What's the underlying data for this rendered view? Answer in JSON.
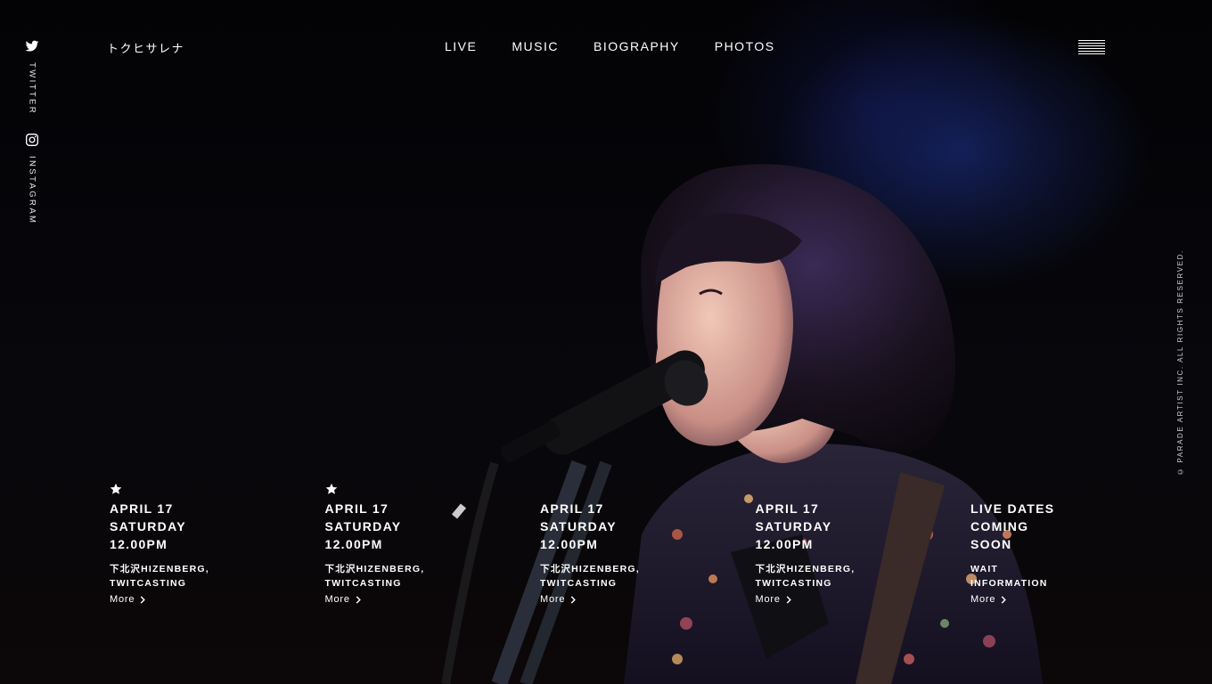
{
  "site": {
    "logo": "トクヒサレナ"
  },
  "social": [
    {
      "icon": "twitter-icon",
      "label": "TWITTER"
    },
    {
      "icon": "instagram-icon",
      "label": "INSTAGRAM"
    }
  ],
  "nav": {
    "items": [
      "LIVE",
      "MUSIC",
      "BIOGRAPHY",
      "PHOTOS"
    ]
  },
  "menu_icon": "hamburger-menu-icon",
  "copyright": "© PARADE ARTIST INC. ALL RIGHTS RESERVED.",
  "events": [
    {
      "starred": true,
      "line1": "APRIL 17",
      "line2": "SATURDAY",
      "line3": "12.00PM",
      "venue1": "下北沢HIZENBERG,",
      "venue2": "TWITCASTING",
      "more": "More"
    },
    {
      "starred": true,
      "line1": "APRIL 17",
      "line2": "SATURDAY",
      "line3": "12.00PM",
      "venue1": "下北沢HIZENBERG,",
      "venue2": "TWITCASTING",
      "more": "More"
    },
    {
      "starred": false,
      "line1": "APRIL 17",
      "line2": "SATURDAY",
      "line3": "12.00PM",
      "venue1": "下北沢HIZENBERG,",
      "venue2": "TWITCASTING",
      "more": "More"
    },
    {
      "starred": false,
      "line1": "APRIL 17",
      "line2": "SATURDAY",
      "line3": "12.00PM",
      "venue1": "下北沢HIZENBERG,",
      "venue2": "TWITCASTING",
      "more": "More"
    },
    {
      "starred": false,
      "line1": "LIVE DATES",
      "line2": "COMING",
      "line3": "SOON",
      "venue1": "WAIT",
      "venue2": "INFORMATION",
      "more": "More"
    }
  ],
  "colors": {
    "background": "#040406",
    "text": "#ffffff",
    "stage_light": "#1e328c"
  }
}
